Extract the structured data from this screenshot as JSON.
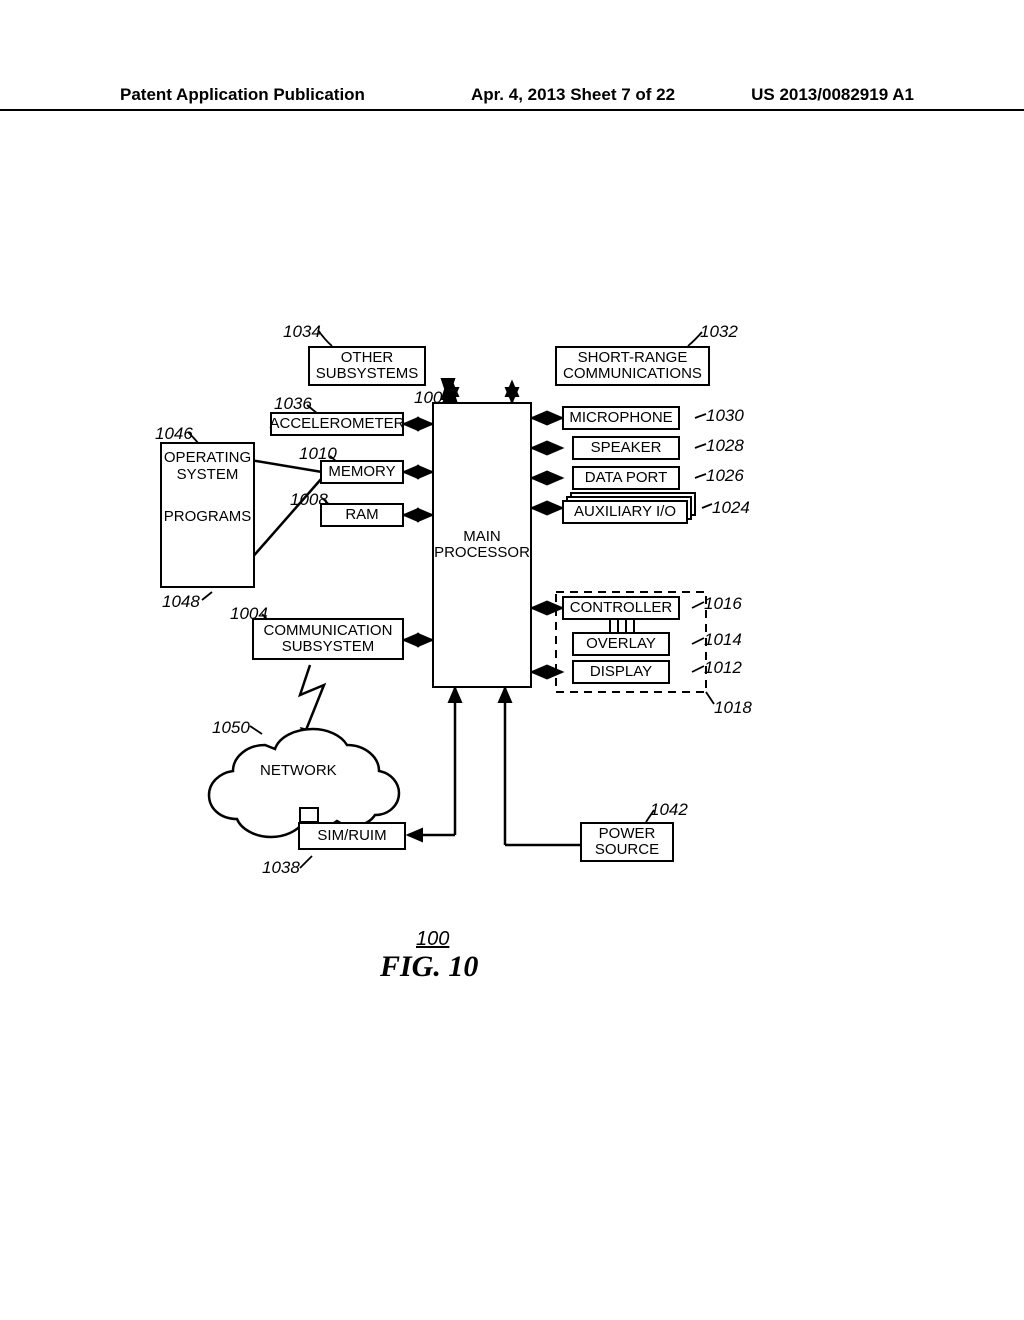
{
  "header": {
    "left": "Patent Application Publication",
    "mid": "Apr. 4, 2013  Sheet 7 of 22",
    "right": "US 2013/0082919 A1"
  },
  "blocks": {
    "other_subsystems": "OTHER\nSUBSYSTEMS",
    "short_range": "SHORT-RANGE\nCOMMUNICATIONS",
    "accelerometer": "ACCELEROMETER",
    "operating_system": "OPERATING\nSYSTEM",
    "programs": "PROGRAMS",
    "memory": "MEMORY",
    "ram": "RAM",
    "main_processor": "MAIN\nPROCESSOR",
    "microphone": "MICROPHONE",
    "speaker": "SPEAKER",
    "data_port": "DATA PORT",
    "aux_io": "AUXILIARY I/O",
    "controller": "CONTROLLER",
    "overlay": "OVERLAY",
    "display": "DISPLAY",
    "comm_subsystem": "COMMUNICATION\nSUBSYSTEM",
    "network": "NETWORK",
    "sim": "SIM/RUIM",
    "power_source": "POWER\nSOURCE"
  },
  "refs": {
    "r1034": "1034",
    "r1032": "1032",
    "r1036": "1036",
    "r1002": "1002",
    "r1046": "1046",
    "r1010": "1010",
    "r1030": "1030",
    "r1028": "1028",
    "r1026": "1026",
    "r1024": "1024",
    "r1008": "1008",
    "r1048": "1048",
    "r1004": "1004",
    "r1016": "1016",
    "r1014": "1014",
    "r1012": "1012",
    "r1018": "1018",
    "r1050": "1050",
    "r1042": "1042",
    "r1038": "1038"
  },
  "figure": {
    "num": "100",
    "caption": "FIG. 10"
  }
}
